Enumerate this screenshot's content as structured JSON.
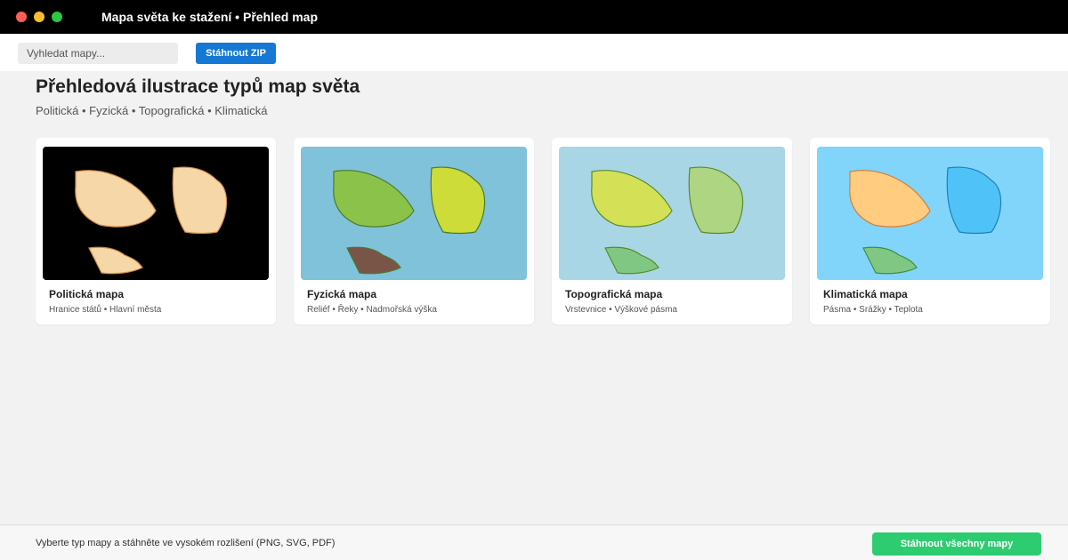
{
  "window": {
    "title": "Mapa světa ke stažení • Přehled map",
    "controls": {
      "close_color": "#ff5f57",
      "minimize_color": "#febc2e",
      "maximize_color": "#28c840"
    }
  },
  "toolbar": {
    "search_placeholder": "Vyhledat mapy...",
    "zip_label": "Stáhnout ZIP",
    "zip_color": "#1478d4"
  },
  "main": {
    "title": "Přehledová ilustrace typů map světa",
    "subtitle": "Politická • Fyzická • Topografická • Klimatická"
  },
  "cards": [
    {
      "title": "Politická mapa",
      "subtitle": "Hranice států • Hlavní města",
      "background": "#000000",
      "stroke": "#d08a45",
      "fills": [
        "#f5d7a8",
        "#f5d7a8",
        "#f5d7a8"
      ]
    },
    {
      "title": "Fyzická mapa",
      "subtitle": "Reliéf • Řeky • Nadmořská výška",
      "background": "#7fc2d9",
      "stroke": "#4a7a2a",
      "fills": [
        "#8bc34a",
        "#cddc39",
        "#795548"
      ]
    },
    {
      "title": "Topografická mapa",
      "subtitle": "Vrstevnice • Výškové pásma",
      "background": "#a9d6e5",
      "stroke": "#5a8a2a",
      "fills": [
        "#d4e157",
        "#aed581",
        "#81c784"
      ]
    },
    {
      "title": "Klimatická mapa",
      "subtitle": "Pásma • Srážky • Teplota",
      "background": "#81d4fa",
      "stroke": "#d0803a",
      "fills": [
        "#ffcc80",
        "#4fc3f7",
        "#81c784"
      ],
      "strokes": [
        "#d0803a",
        "#1f7fb8",
        "#3f8f3f"
      ]
    }
  ],
  "footer": {
    "text": "Vyberte typ mapy a stáhněte ve vysokém rozlišení (PNG, SVG, PDF)",
    "button_label": "Stáhnout všechny mapy",
    "button_color": "#2ecc71"
  }
}
